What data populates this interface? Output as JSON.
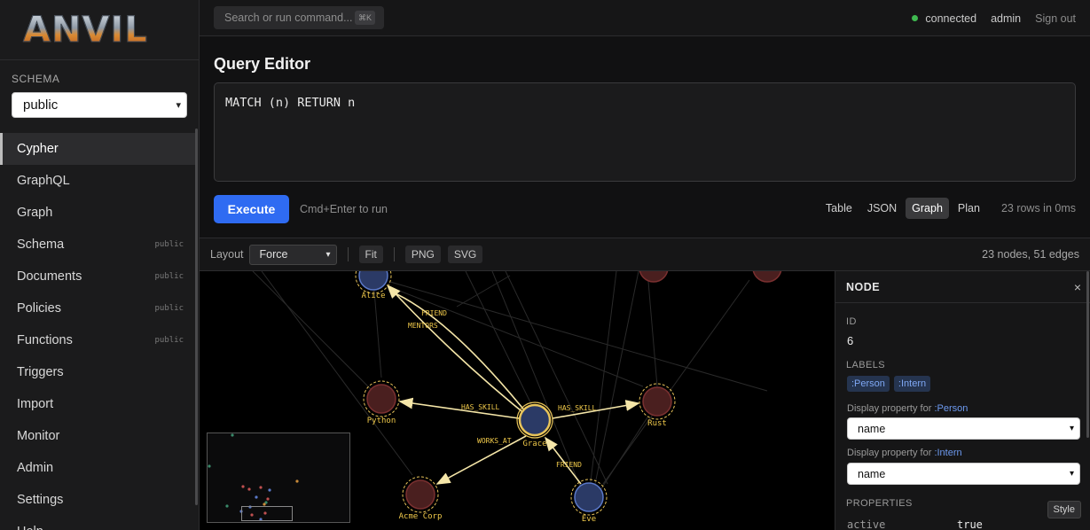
{
  "app": {
    "logo_text": "ANVIL"
  },
  "sidebar": {
    "schema_label": "SCHEMA",
    "schema_value": "public",
    "items": [
      {
        "label": "Cypher",
        "badge": ""
      },
      {
        "label": "GraphQL",
        "badge": ""
      },
      {
        "label": "Graph",
        "badge": ""
      },
      {
        "label": "Schema",
        "badge": "public"
      },
      {
        "label": "Documents",
        "badge": "public"
      },
      {
        "label": "Policies",
        "badge": "public"
      },
      {
        "label": "Functions",
        "badge": "public"
      },
      {
        "label": "Triggers",
        "badge": ""
      },
      {
        "label": "Import",
        "badge": ""
      },
      {
        "label": "Monitor",
        "badge": ""
      },
      {
        "label": "Admin",
        "badge": ""
      },
      {
        "label": "Settings",
        "badge": ""
      },
      {
        "label": "Help",
        "badge": ""
      }
    ]
  },
  "topbar": {
    "search_placeholder": "Search or run command...",
    "search_shortcut": "⌘K",
    "status": "connected",
    "status_color": "#3fb950",
    "user": "admin",
    "sign_out": "Sign out"
  },
  "query": {
    "title": "Query Editor",
    "text": "MATCH (n) RETURN n",
    "execute_label": "Execute",
    "run_hint": "Cmd+Enter to run",
    "views": [
      "Table",
      "JSON",
      "Graph",
      "Plan"
    ],
    "active_view": "Graph",
    "rows_info": "23 rows in 0ms"
  },
  "graph_toolbar": {
    "layout_label": "Layout",
    "layout_value": "Force",
    "fit_label": "Fit",
    "png_label": "PNG",
    "svg_label": "SVG",
    "stats": "23 nodes, 51 edges"
  },
  "graph": {
    "nodes": [
      {
        "name": "Alice",
        "kind": "person"
      },
      {
        "name": "Python",
        "kind": "skill"
      },
      {
        "name": "Grace",
        "kind": "person",
        "selected": true
      },
      {
        "name": "Rust",
        "kind": "skill"
      },
      {
        "name": "Acme Corp",
        "kind": "company"
      },
      {
        "name": "Eve",
        "kind": "person"
      }
    ],
    "edge_labels": [
      "FRIEND",
      "MENTORS",
      "HAS_SKILL",
      "HAS_SKILL",
      "WORKS_AT",
      "FRIEND"
    ],
    "colors": {
      "person": "#2b3a66",
      "skill": "#4a1f1f",
      "company": "#4a1f1f",
      "highlight": "#f5e6a8",
      "label": "#f0c94a"
    }
  },
  "node_panel": {
    "title": "NODE",
    "close": "×",
    "id_label": "ID",
    "id_value": "6",
    "labels_label": "LABELS",
    "labels": [
      ":Person",
      ":Intern"
    ],
    "display_prefix": "Display property for",
    "display_1_label": ":Person",
    "display_1_value": "name",
    "display_2_label": ":Intern",
    "display_2_value": "name",
    "properties_label": "PROPERTIES",
    "prop_key": "active",
    "prop_value": "true",
    "style_button": "Style"
  }
}
